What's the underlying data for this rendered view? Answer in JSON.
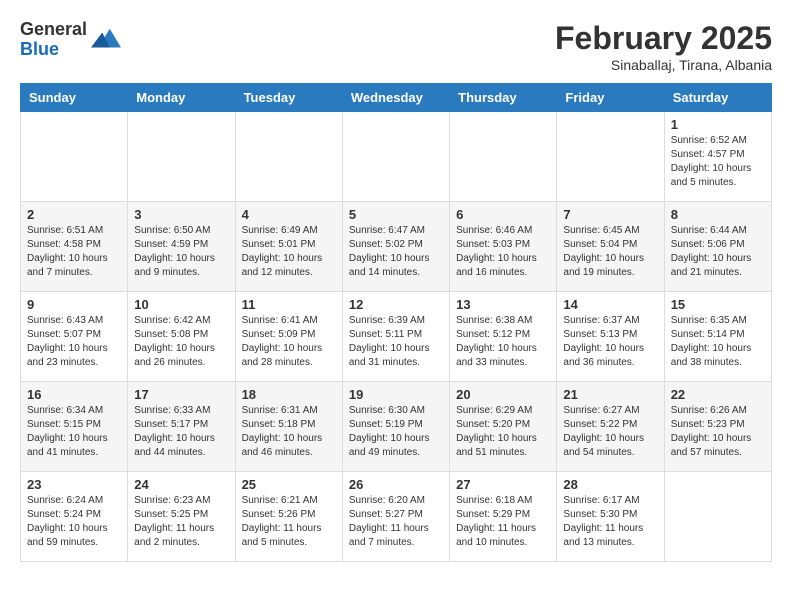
{
  "logo": {
    "general": "General",
    "blue": "Blue"
  },
  "title": "February 2025",
  "location": "Sinaballaj, Tirana, Albania",
  "days_of_week": [
    "Sunday",
    "Monday",
    "Tuesday",
    "Wednesday",
    "Thursday",
    "Friday",
    "Saturday"
  ],
  "weeks": [
    [
      {
        "num": "",
        "info": ""
      },
      {
        "num": "",
        "info": ""
      },
      {
        "num": "",
        "info": ""
      },
      {
        "num": "",
        "info": ""
      },
      {
        "num": "",
        "info": ""
      },
      {
        "num": "",
        "info": ""
      },
      {
        "num": "1",
        "info": "Sunrise: 6:52 AM\nSunset: 4:57 PM\nDaylight: 10 hours\nand 5 minutes."
      }
    ],
    [
      {
        "num": "2",
        "info": "Sunrise: 6:51 AM\nSunset: 4:58 PM\nDaylight: 10 hours\nand 7 minutes."
      },
      {
        "num": "3",
        "info": "Sunrise: 6:50 AM\nSunset: 4:59 PM\nDaylight: 10 hours\nand 9 minutes."
      },
      {
        "num": "4",
        "info": "Sunrise: 6:49 AM\nSunset: 5:01 PM\nDaylight: 10 hours\nand 12 minutes."
      },
      {
        "num": "5",
        "info": "Sunrise: 6:47 AM\nSunset: 5:02 PM\nDaylight: 10 hours\nand 14 minutes."
      },
      {
        "num": "6",
        "info": "Sunrise: 6:46 AM\nSunset: 5:03 PM\nDaylight: 10 hours\nand 16 minutes."
      },
      {
        "num": "7",
        "info": "Sunrise: 6:45 AM\nSunset: 5:04 PM\nDaylight: 10 hours\nand 19 minutes."
      },
      {
        "num": "8",
        "info": "Sunrise: 6:44 AM\nSunset: 5:06 PM\nDaylight: 10 hours\nand 21 minutes."
      }
    ],
    [
      {
        "num": "9",
        "info": "Sunrise: 6:43 AM\nSunset: 5:07 PM\nDaylight: 10 hours\nand 23 minutes."
      },
      {
        "num": "10",
        "info": "Sunrise: 6:42 AM\nSunset: 5:08 PM\nDaylight: 10 hours\nand 26 minutes."
      },
      {
        "num": "11",
        "info": "Sunrise: 6:41 AM\nSunset: 5:09 PM\nDaylight: 10 hours\nand 28 minutes."
      },
      {
        "num": "12",
        "info": "Sunrise: 6:39 AM\nSunset: 5:11 PM\nDaylight: 10 hours\nand 31 minutes."
      },
      {
        "num": "13",
        "info": "Sunrise: 6:38 AM\nSunset: 5:12 PM\nDaylight: 10 hours\nand 33 minutes."
      },
      {
        "num": "14",
        "info": "Sunrise: 6:37 AM\nSunset: 5:13 PM\nDaylight: 10 hours\nand 36 minutes."
      },
      {
        "num": "15",
        "info": "Sunrise: 6:35 AM\nSunset: 5:14 PM\nDaylight: 10 hours\nand 38 minutes."
      }
    ],
    [
      {
        "num": "16",
        "info": "Sunrise: 6:34 AM\nSunset: 5:15 PM\nDaylight: 10 hours\nand 41 minutes."
      },
      {
        "num": "17",
        "info": "Sunrise: 6:33 AM\nSunset: 5:17 PM\nDaylight: 10 hours\nand 44 minutes."
      },
      {
        "num": "18",
        "info": "Sunrise: 6:31 AM\nSunset: 5:18 PM\nDaylight: 10 hours\nand 46 minutes."
      },
      {
        "num": "19",
        "info": "Sunrise: 6:30 AM\nSunset: 5:19 PM\nDaylight: 10 hours\nand 49 minutes."
      },
      {
        "num": "20",
        "info": "Sunrise: 6:29 AM\nSunset: 5:20 PM\nDaylight: 10 hours\nand 51 minutes."
      },
      {
        "num": "21",
        "info": "Sunrise: 6:27 AM\nSunset: 5:22 PM\nDaylight: 10 hours\nand 54 minutes."
      },
      {
        "num": "22",
        "info": "Sunrise: 6:26 AM\nSunset: 5:23 PM\nDaylight: 10 hours\nand 57 minutes."
      }
    ],
    [
      {
        "num": "23",
        "info": "Sunrise: 6:24 AM\nSunset: 5:24 PM\nDaylight: 10 hours\nand 59 minutes."
      },
      {
        "num": "24",
        "info": "Sunrise: 6:23 AM\nSunset: 5:25 PM\nDaylight: 11 hours\nand 2 minutes."
      },
      {
        "num": "25",
        "info": "Sunrise: 6:21 AM\nSunset: 5:26 PM\nDaylight: 11 hours\nand 5 minutes."
      },
      {
        "num": "26",
        "info": "Sunrise: 6:20 AM\nSunset: 5:27 PM\nDaylight: 11 hours\nand 7 minutes."
      },
      {
        "num": "27",
        "info": "Sunrise: 6:18 AM\nSunset: 5:29 PM\nDaylight: 11 hours\nand 10 minutes."
      },
      {
        "num": "28",
        "info": "Sunrise: 6:17 AM\nSunset: 5:30 PM\nDaylight: 11 hours\nand 13 minutes."
      },
      {
        "num": "",
        "info": ""
      }
    ]
  ]
}
